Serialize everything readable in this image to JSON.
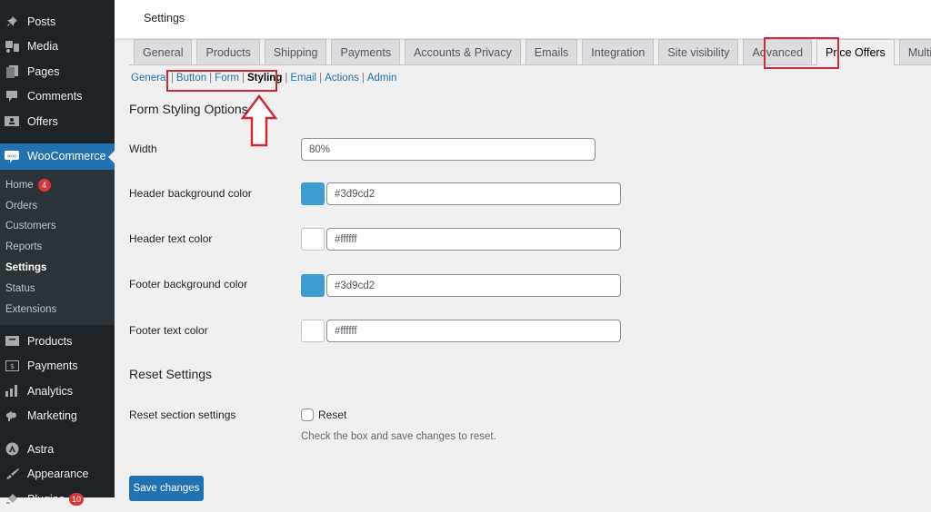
{
  "sidebar": {
    "top_items": [
      {
        "label": "Posts",
        "icon": "pin-icon"
      },
      {
        "label": "Media",
        "icon": "media-icon"
      },
      {
        "label": "Pages",
        "icon": "pages-icon"
      },
      {
        "label": "Comments",
        "icon": "comment-icon"
      },
      {
        "label": "Offers",
        "icon": "offers-icon"
      }
    ],
    "woocommerce": {
      "label": "WooCommerce",
      "icon": "woo-icon"
    },
    "sub_items": [
      {
        "label": "Home",
        "badge": "4"
      },
      {
        "label": "Orders"
      },
      {
        "label": "Customers"
      },
      {
        "label": "Reports"
      },
      {
        "label": "Settings",
        "current": true
      },
      {
        "label": "Status"
      },
      {
        "label": "Extensions"
      }
    ],
    "bottom_items": [
      {
        "label": "Products",
        "icon": "archive-icon"
      },
      {
        "label": "Payments",
        "icon": "dollar-icon"
      },
      {
        "label": "Analytics",
        "icon": "bar-chart-icon"
      },
      {
        "label": "Marketing",
        "icon": "megaphone-icon"
      },
      {
        "label": "Astra",
        "icon": "astra-icon"
      },
      {
        "label": "Appearance",
        "icon": "brush-icon"
      },
      {
        "label": "Plugins",
        "icon": "plug-icon",
        "badge": "10"
      }
    ]
  },
  "header": {
    "title": "Settings"
  },
  "tabs": [
    "General",
    "Products",
    "Shipping",
    "Payments",
    "Accounts & Privacy",
    "Emails",
    "Integration",
    "Site visibility",
    "Advanced",
    "Price Offers",
    "Multi-currency"
  ],
  "active_tab": "Price Offers",
  "subnav": {
    "items": [
      "General",
      "Button",
      "Form",
      "Styling",
      "Email",
      "Actions",
      "Admin"
    ],
    "current": "Styling"
  },
  "form": {
    "section_title": "Form Styling Options",
    "width": {
      "label": "Width",
      "value": "80%"
    },
    "header_bg": {
      "label": "Header background color",
      "value": "#3d9cd2",
      "swatch": "#3d9cd2"
    },
    "header_text": {
      "label": "Header text color",
      "value": "#ffffff",
      "swatch": "#ffffff"
    },
    "footer_bg": {
      "label": "Footer background color",
      "value": "#3d9cd2",
      "swatch": "#3d9cd2"
    },
    "footer_text": {
      "label": "Footer text color",
      "value": "#ffffff",
      "swatch": "#ffffff"
    }
  },
  "reset": {
    "section_title": "Reset Settings",
    "label": "Reset section settings",
    "checkbox_label": "Reset",
    "checked": false,
    "description": "Check the box and save changes to reset."
  },
  "save_label": "Save changes",
  "colors": {
    "highlight": "#d12a37",
    "accent": "#2271b1"
  }
}
